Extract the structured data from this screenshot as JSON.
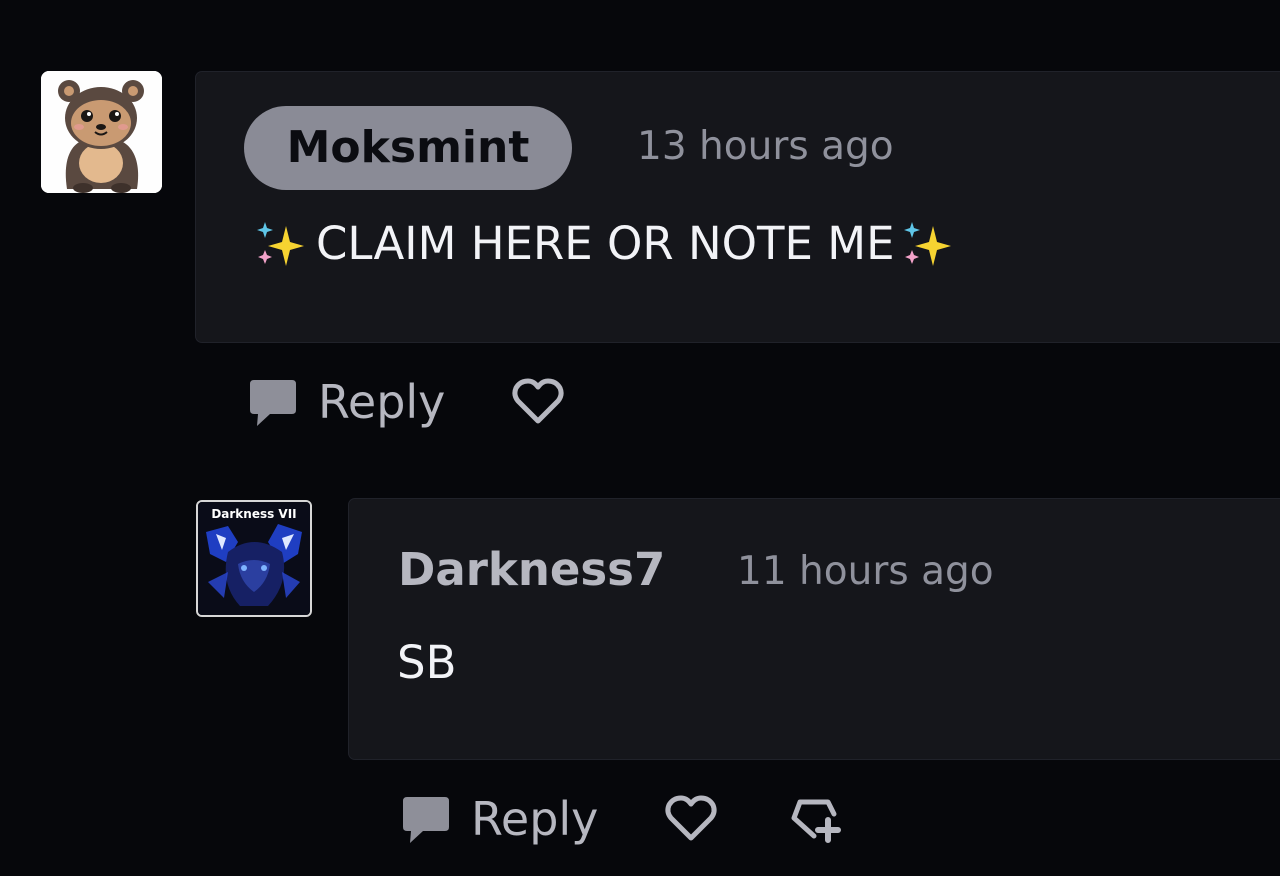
{
  "comments": [
    {
      "author": "Moksmint",
      "timestamp": "13 hours ago",
      "body": "CLAIM HERE OR NOTE ME",
      "reply_label": "Reply"
    }
  ],
  "replies": [
    {
      "author": "Darkness7",
      "avatar_caption": "Darkness VII",
      "timestamp": "11 hours ago",
      "body": "SB",
      "reply_label": "Reply"
    }
  ],
  "colors": {
    "background": "#06070b",
    "card": "#15161b",
    "username_pill": "#8a8b96",
    "muted_text": "#8f919c",
    "action_text": "#b6b7c0",
    "body_text": "#f2f3f7",
    "sparkle_yellow": "#f6d331"
  },
  "icons": {
    "reply": "speech-bubble-icon",
    "like": "heart-icon",
    "favourite": "heart-plus-icon",
    "sparkles": "sparkles-emoji-icon"
  }
}
